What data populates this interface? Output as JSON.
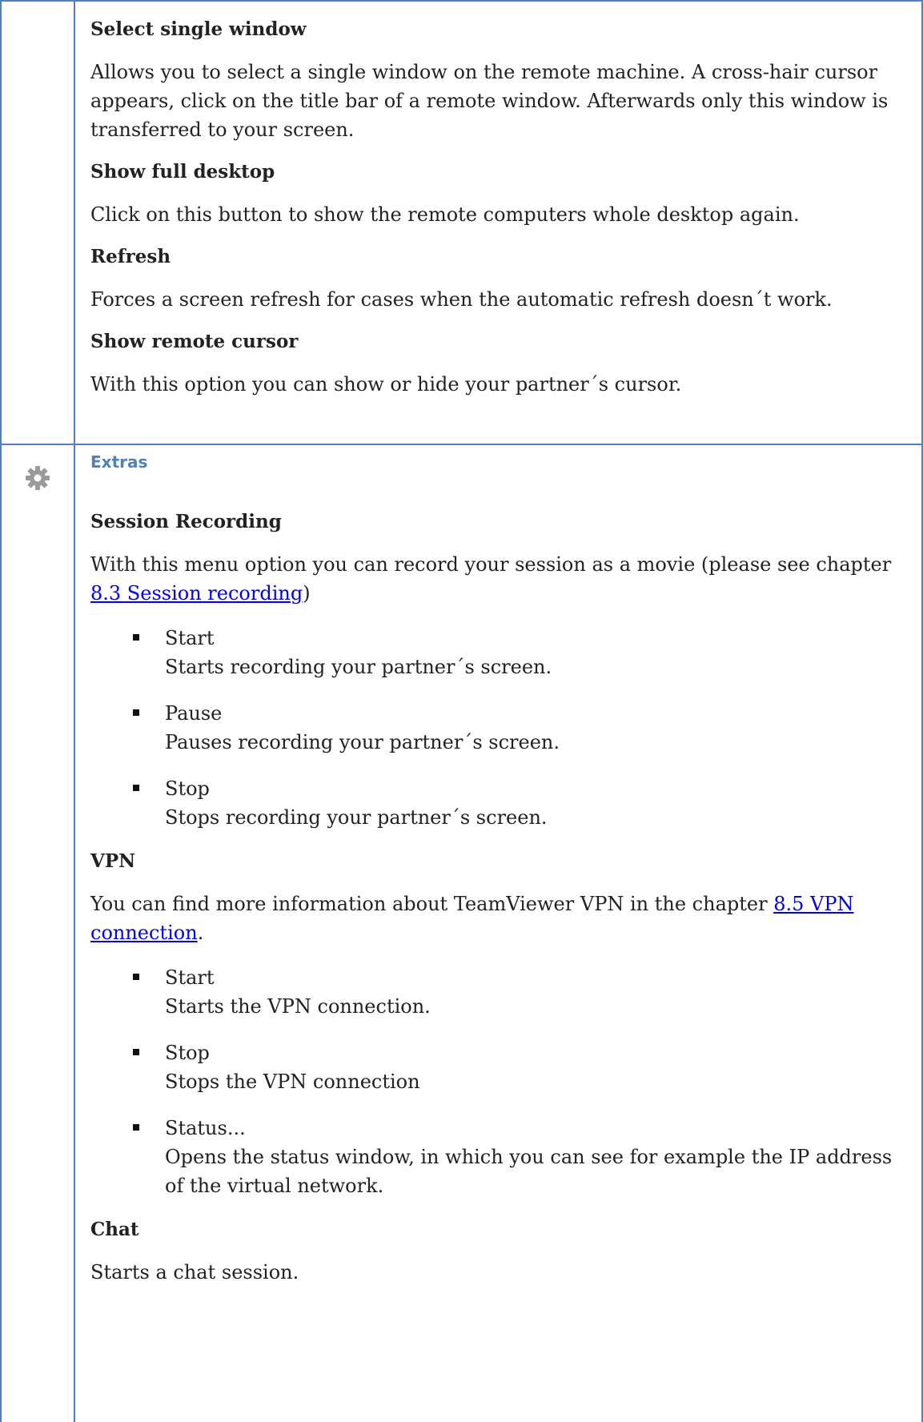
{
  "row1": {
    "items": [
      {
        "title": "Select single window",
        "text": "Allows you to select a single window on the remote machine. A cross-hair cursor appears, click on the title bar of a remote window.  Afterwards  only  this window is transferred to your screen."
      },
      {
        "title": "Show full desktop",
        "text": "Click on this button to show the remote computers whole desktop again."
      },
      {
        "title": "Refresh",
        "text": "Forces a screen refresh for cases when the automatic refresh doesn´t work."
      },
      {
        "title": "Show remote cursor",
        "text": "With this option you can show or hide your partner´s cursor."
      }
    ]
  },
  "row2": {
    "icon": "gear-icon",
    "section_title": "Extras",
    "session_recording": {
      "title": "Session Recording",
      "text_before": "With this menu option you can record your session as a movie (please see chapter ",
      "link": "8.3 Session recording",
      "text_after": ")",
      "bullets": [
        {
          "label": "Start",
          "desc": "Starts recording your partner´s screen."
        },
        {
          "label": "Pause",
          "desc": "Pauses recording your partner´s screen."
        },
        {
          "label": "Stop",
          "desc": "Stops recording your partner´s screen."
        }
      ]
    },
    "vpn": {
      "title": "VPN",
      "text_before": "You can find more information about TeamViewer VPN in the chapter ",
      "link": "8.5 VPN connection",
      "text_after": ".",
      "bullets": [
        {
          "label": "Start",
          "desc": "Starts the VPN connection."
        },
        {
          "label": "Stop",
          "desc": "Stops the VPN connection"
        },
        {
          "label": "Status...",
          "desc": "Opens the status window, in which you can see for example the IP address of the virtual network."
        }
      ]
    },
    "chat": {
      "title": "Chat",
      "text": "Starts a chat session."
    }
  },
  "colors": {
    "border": "#4f81bd",
    "section_title": "#4f81bd",
    "link": "#0000ee"
  }
}
